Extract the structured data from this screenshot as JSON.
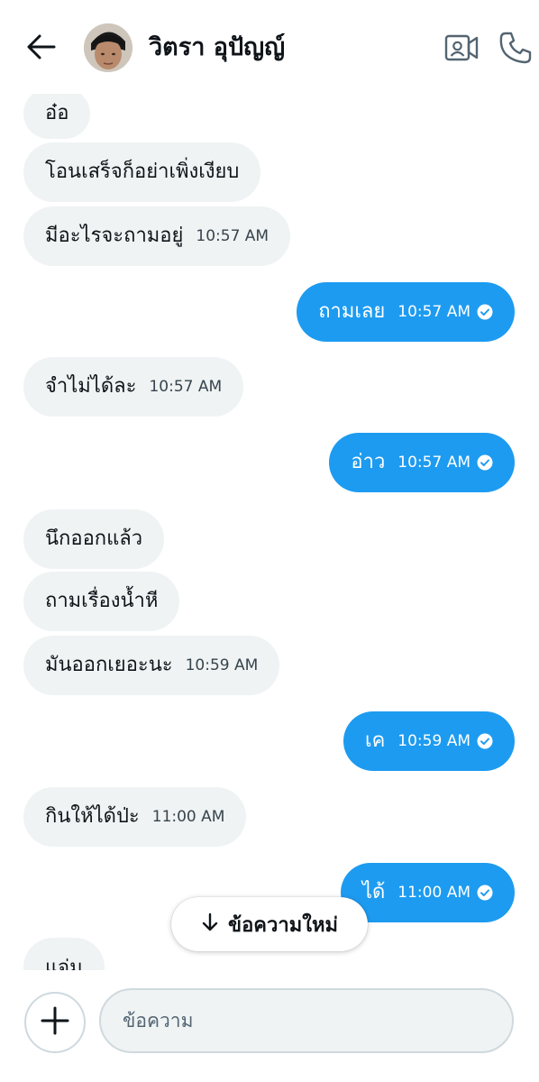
{
  "header": {
    "contact_name": "วิตรา อุปัญญ์",
    "icons": [
      "back-arrow-icon",
      "video-camera-icon",
      "phone-icon"
    ]
  },
  "messages": [
    {
      "direction": "in",
      "text": "อ๋อ",
      "time": ""
    },
    {
      "direction": "in",
      "text": "โอนเสร็จก็อย่าเพิ่งเงียบ",
      "time": ""
    },
    {
      "direction": "in",
      "text": "มีอะไรจะถามอยู่",
      "time": "10:57 AM"
    },
    {
      "direction": "out",
      "text": "ถามเลย",
      "time": "10:57 AM",
      "seen": true
    },
    {
      "direction": "in",
      "text": "จำไม่ได้ละ",
      "time": "10:57 AM"
    },
    {
      "direction": "out",
      "text": "อ่าว",
      "time": "10:57 AM",
      "seen": true
    },
    {
      "direction": "in",
      "text": "นึกออกแล้ว",
      "time": ""
    },
    {
      "direction": "in",
      "text": "ถามเรื่องน้ำหี",
      "time": ""
    },
    {
      "direction": "in",
      "text": "มันออกเยอะนะ",
      "time": "10:59 AM"
    },
    {
      "direction": "out",
      "text": "เค",
      "time": "10:59 AM",
      "seen": true
    },
    {
      "direction": "in",
      "text": "กินให้ได้ป่ะ",
      "time": "11:00 AM"
    },
    {
      "direction": "out",
      "text": "ได้",
      "time": "11:00 AM",
      "seen": true
    },
    {
      "direction": "in",
      "text": "แจ่ม",
      "time": ""
    }
  ],
  "new_messages_label": "ข้อความใหม่",
  "composer": {
    "placeholder": "ข้อความ"
  },
  "colors": {
    "outgoing_bubble": "#1d9bf0",
    "incoming_bubble": "#eff3f4",
    "text": "#0f1419"
  }
}
